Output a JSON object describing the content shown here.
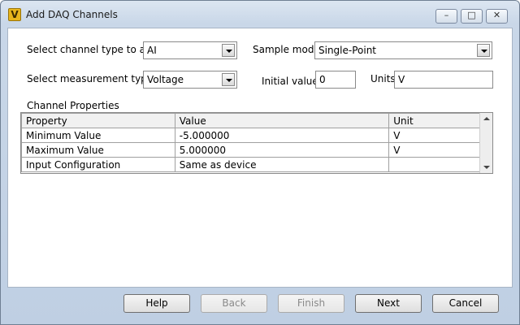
{
  "window": {
    "title": "Add DAQ Channels",
    "icon": "labview-v-icon",
    "icon_glyph": "V",
    "min_glyph": "–",
    "max_glyph": "□",
    "close_glyph": "✕"
  },
  "form": {
    "channel_type_label": "Select channel type to add",
    "channel_type_value": "AI",
    "sample_mode_label": "Sample mode",
    "sample_mode_value": "Single-Point",
    "measurement_type_label": "Select measurement type",
    "measurement_type_value": "Voltage",
    "initial_value_label": "Initial value",
    "initial_value": "0",
    "units_label": "Units",
    "units_value": "V"
  },
  "properties": {
    "title": "Channel Properties",
    "columns": [
      "Property",
      "Value",
      "Unit"
    ],
    "rows": [
      [
        "Minimum Value",
        "-5.000000",
        "V"
      ],
      [
        "Maximum Value",
        "5.000000",
        "V"
      ],
      [
        "Input Configuration",
        "Same as device",
        ""
      ]
    ]
  },
  "buttons": {
    "help": "Help",
    "back": "Back",
    "finish": "Finish",
    "next": "Next",
    "cancel": "Cancel"
  }
}
